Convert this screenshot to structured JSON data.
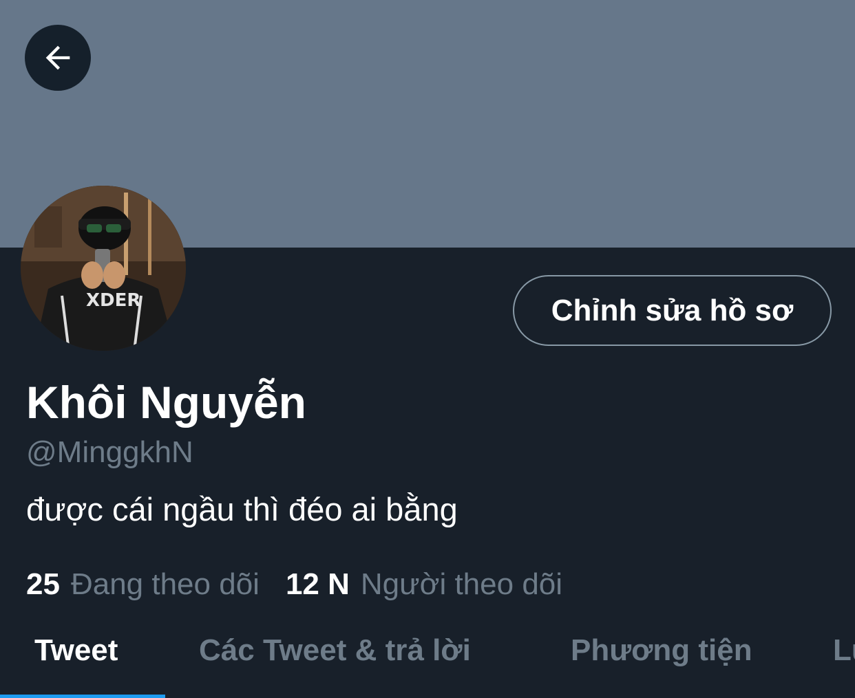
{
  "header": {
    "back_icon": "arrow-left-icon"
  },
  "colors": {
    "banner": "#66778a",
    "background": "#18202a",
    "accent": "#1d9bf0",
    "muted_text": "#6e7c89"
  },
  "profile": {
    "edit_button_label": "Chỉnh sửa hồ sơ",
    "display_name": "Khôi Nguyễn",
    "handle": "@MinggkhN",
    "bio": "được cái ngầu thì đéo ai bằng",
    "following_count": "25",
    "following_label": "Đang theo dõi",
    "followers_count": "12 N",
    "followers_label": "Người theo dõi"
  },
  "tabs": [
    {
      "label": "Tweet",
      "active": true
    },
    {
      "label": "Các Tweet & trả lời",
      "active": false
    },
    {
      "label": "Phương tiện",
      "active": false
    },
    {
      "label": "Lượt thích",
      "active": false
    }
  ]
}
